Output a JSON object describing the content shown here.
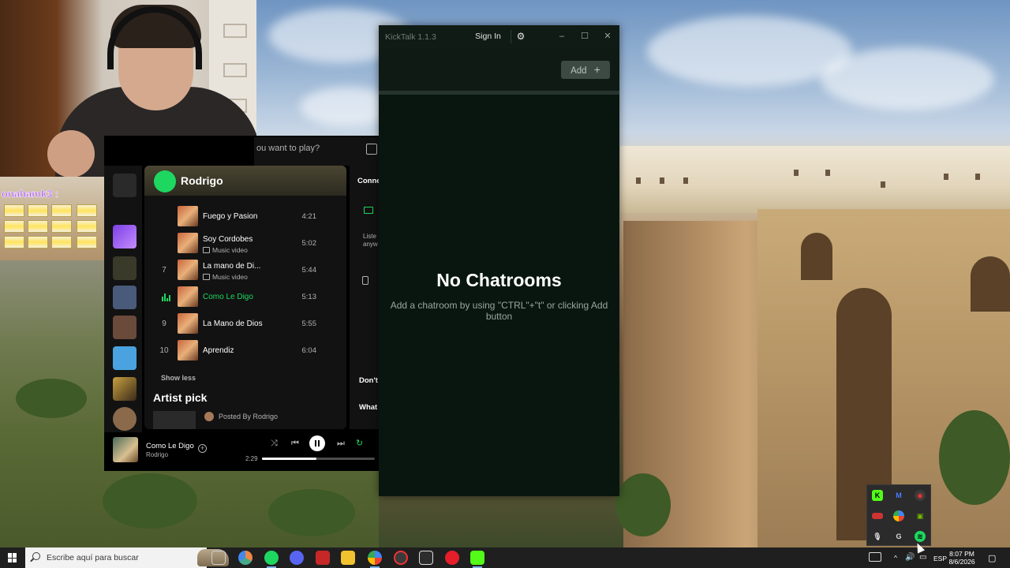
{
  "overlay": {
    "username": "onahamk3 :"
  },
  "spotify": {
    "search_placeholder": "ou want to play?",
    "artist_name": "Rodrigo",
    "right_panel": {
      "connect_label": "Conne",
      "listen_text": "Liste anyw",
      "dont_text": "Don't",
      "what_text": "What"
    },
    "tracks": [
      {
        "num": "",
        "title": "Fuego y Pasion",
        "sub": "",
        "duration": "4:21",
        "active": false
      },
      {
        "num": "",
        "title": "Soy Cordobes",
        "sub": "Music video",
        "duration": "5:02",
        "active": false
      },
      {
        "num": "7",
        "title": "La mano de Di...",
        "sub": "Music video",
        "duration": "5:44",
        "active": false
      },
      {
        "num": "",
        "title": "Como Le Digo",
        "sub": "",
        "duration": "5:13",
        "active": true
      },
      {
        "num": "9",
        "title": "La Mano de Dios",
        "sub": "",
        "duration": "5:55",
        "active": false
      },
      {
        "num": "10",
        "title": "Aprendiz",
        "sub": "",
        "duration": "6:04",
        "active": false
      }
    ],
    "show_less_label": "Show less",
    "artist_pick_heading": "Artist pick",
    "posted_by": "Posted By Rodrigo",
    "now_playing": {
      "title": "Como Le Digo",
      "artist": "Rodrigo",
      "elapsed": "2:29",
      "progress": 0.48
    }
  },
  "kicktalk": {
    "title": "KickTalk 1.1.3",
    "sign_in_label": "Sign In",
    "add_label": "Add",
    "add_icon": "+",
    "empty_title": "No Chatrooms",
    "empty_description": "Add a chatroom by using \"CTRL\"+\"t\" or clicking Add button"
  },
  "taskbar": {
    "search_placeholder": "Escribe aquí para buscar",
    "language": "ESP",
    "time": "8:07 PM",
    "date": "8/6/2026"
  },
  "colors": {
    "spotify_green": "#1ed760",
    "kick_green": "#53fc18",
    "kicktalk_bg": "#08160f"
  }
}
